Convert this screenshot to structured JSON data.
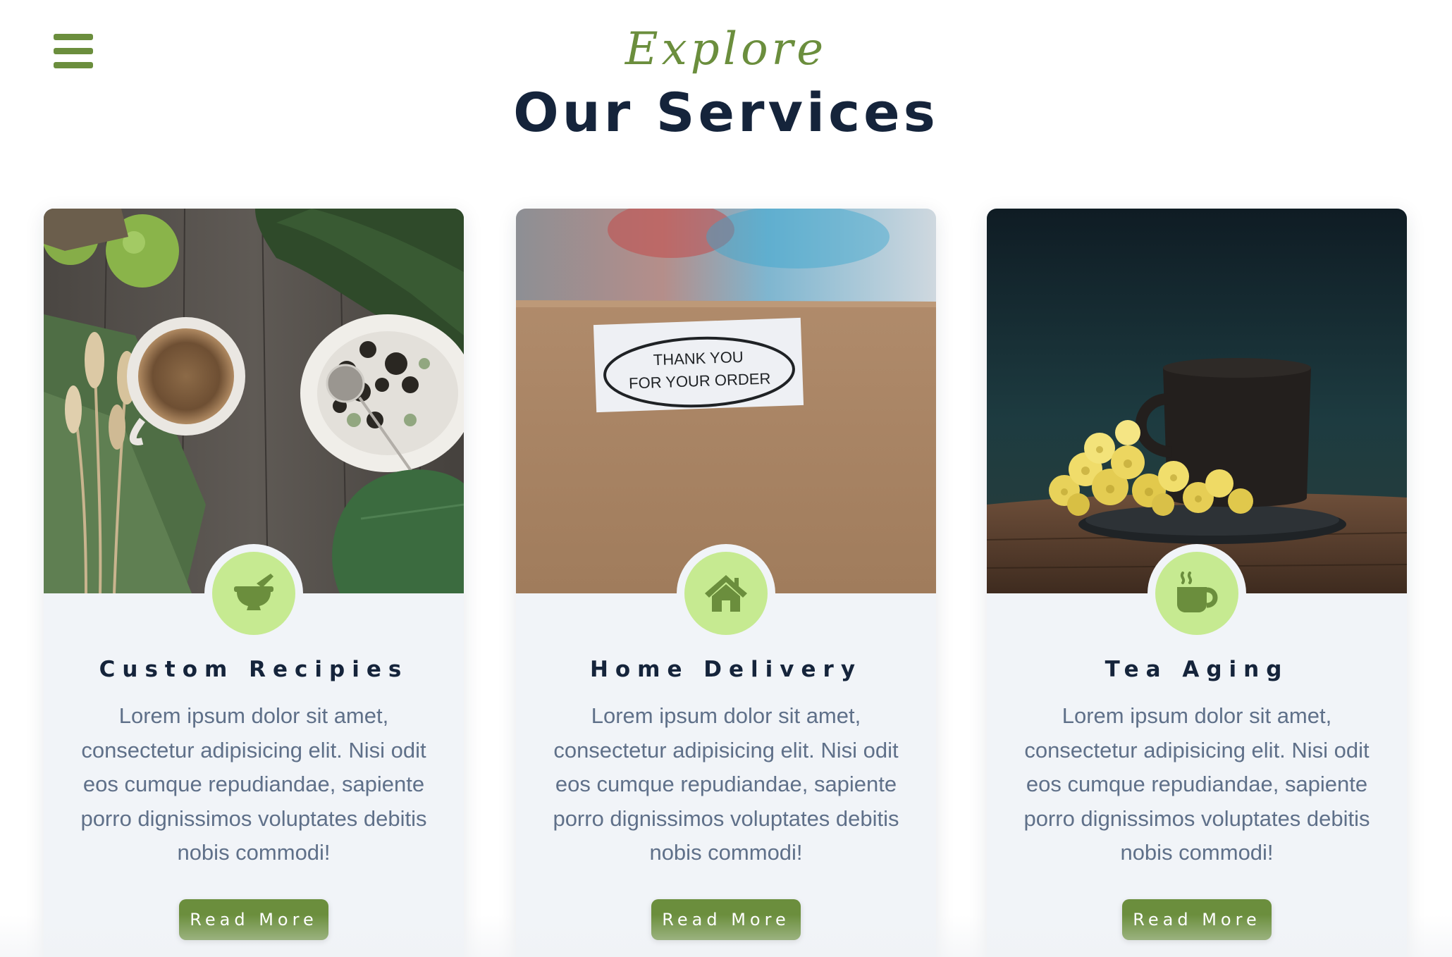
{
  "header": {
    "eyebrow": "Explore",
    "title": "Our Services"
  },
  "nav": {
    "menu_icon": "hamburger-menu-icon"
  },
  "colors": {
    "accent": "#6b8e3d",
    "badge": "#c6ea91",
    "heading": "#15243b",
    "body_text": "#5f7089",
    "card_bg": "#f1f4f8"
  },
  "cards": [
    {
      "title": "Custom Recipies",
      "text": "Lorem ipsum dolor sit amet, consectetur adipisicing elit. Nisi odit eos cumque repudiandae, sapiente porro dignissimos voluptates debitis nobis commodi!",
      "button": "Read More",
      "icon": "mortar-pestle-icon"
    },
    {
      "title": "Home Delivery",
      "text": "Lorem ipsum dolor sit amet, consectetur adipisicing elit. Nisi odit eos cumque repudiandae, sapiente porro dignissimos voluptates debitis nobis commodi!",
      "button": "Read More",
      "icon": "house-icon",
      "photo_label": {
        "line1": "THANK YOU",
        "line2": "FOR YOUR ORDER"
      }
    },
    {
      "title": "Tea Aging",
      "text": "Lorem ipsum dolor sit amet, consectetur adipisicing elit. Nisi odit eos cumque repudiandae, sapiente porro dignissimos voluptates debitis nobis commodi!",
      "button": "Read More",
      "icon": "hot-cup-icon"
    }
  ]
}
